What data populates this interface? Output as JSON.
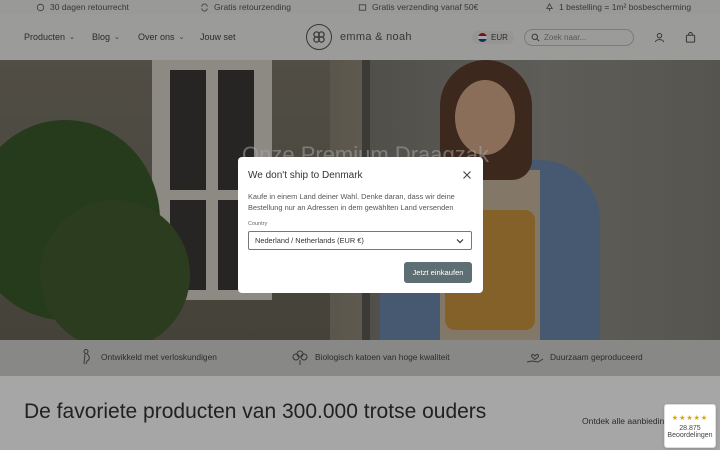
{
  "topbar": {
    "usps": [
      {
        "icon": "refresh-box-icon",
        "text": "30 dagen retourrecht"
      },
      {
        "icon": "return-arrows-icon",
        "text": "Gratis retourzending"
      },
      {
        "icon": "delivery-box-icon",
        "text": "Gratis verzending vanaf 50€"
      },
      {
        "icon": "tree-icon",
        "text": "1 bestelling = 1m² bosbescherming"
      }
    ]
  },
  "header": {
    "nav": [
      {
        "label": "Producten",
        "dropdown": true
      },
      {
        "label": "Blog",
        "dropdown": true
      },
      {
        "label": "Over ons",
        "dropdown": true
      },
      {
        "label": "Jouw set",
        "dropdown": false
      }
    ],
    "logo_text": "emma & noah",
    "currency": "EUR",
    "search_placeholder": "Zoek naar...",
    "account_icon": "user-icon",
    "cart_icon": "bag-icon"
  },
  "hero": {
    "title": "Onze Premium Draagzak"
  },
  "modal": {
    "title": "We don't ship to Denmark",
    "body": "Kaufe in einem Land deiner Wahl. Denke daran, dass wir deine Bestellung nur an Adressen in dem gewählten Land versenden",
    "country_label": "Country",
    "country_value": "Nederland / Netherlands (EUR €)",
    "button": "Jetzt einkaufen"
  },
  "features": [
    {
      "icon": "pregnant-icon",
      "text": "Ontwikkeld met verloskundigen"
    },
    {
      "icon": "cotton-icon",
      "text": "Biologisch katoen van hoge kwaliteit"
    },
    {
      "icon": "hand-heart-icon",
      "text": "Duurzaam geproduceerd"
    }
  ],
  "section": {
    "title": "De favoriete producten van 300.000 trotse ouders",
    "link": "Ontdek alle aanbiedingen"
  },
  "rating": {
    "stars": "★★★★★",
    "count": "28.875",
    "label": "Beoordelingen"
  },
  "colors": {
    "button": "#5e6f74",
    "star": "#d9a300"
  }
}
